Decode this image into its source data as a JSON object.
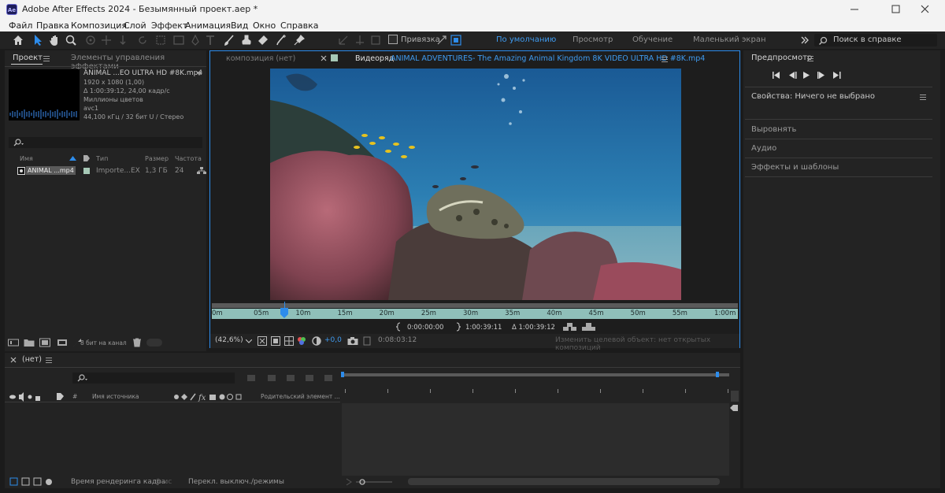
{
  "window": {
    "title": "Adobe After Effects 2024 - Безымянный проект.aep *",
    "logo": "Ae"
  },
  "menu": [
    "Файл",
    "Правка",
    "Композиция",
    "Слой",
    "Эффект",
    "Анимация",
    "Вид",
    "Окно",
    "Справка"
  ],
  "toolbar": {
    "snap_label": "Привязка",
    "workspaces": [
      "По умолчанию",
      "Просмотр",
      "Обучение",
      "Маленький экран"
    ],
    "search_placeholder": "Поиск в справке"
  },
  "project_panel": {
    "tab_project": "Проект",
    "tab_effects": "Элементы управления эффектами",
    "file_name": "ANIMAL ...EO ULTRA HD #8K.mp4",
    "info": [
      "1920 x 1080 (1,00)",
      "Δ 1:00:39:12, 24,00 кадр/с",
      "Миллионы цветов",
      "avc1",
      "44,100 кГц / 32 бит U / Стерео"
    ],
    "columns": {
      "name": "Имя",
      "type": "Тип",
      "size": "Размер",
      "rate": "Частота ..."
    },
    "rows": [
      {
        "name": "ANIMAL ...mp4",
        "type": "Importe...EX",
        "size": "1,3 ГБ",
        "rate": "24"
      }
    ],
    "bit_depth": "8 бит на канал"
  },
  "viewer": {
    "tab_comp": "композиция  (нет)",
    "tab_footage_prefix": "Видеоряд",
    "tab_footage_name": "ANIMAL ADVENTURES- The Amazing Animal Kingdom 8K VIDEO ULTRA HD #8K.mp4",
    "ruler_labels": [
      "0m",
      "05m",
      "10m",
      "15m",
      "20m",
      "25m",
      "30m",
      "35m",
      "40m",
      "45m",
      "50m",
      "55m",
      "1:00m"
    ],
    "in_point": "0:00:00:00",
    "out_point": "1:00:39:11",
    "duration": "Δ 1:00:39:12",
    "zoom": "(42,6%)",
    "exposure": "+0,0",
    "current_time": "0:08:03:12",
    "target_hint": "Изменить целевой объект: нет открытых композиций"
  },
  "right_panel": {
    "preview_title": "Предпросмотр",
    "properties": "Свойства: Ничего не выбрано",
    "items": [
      "Выровнять",
      "Аудио",
      "Эффекты и шаблоны"
    ]
  },
  "timeline": {
    "tab": "(нет)",
    "col_source": "Имя источника",
    "col_parent": "Родительский элемент ...",
    "col_hash": "#",
    "render_time_label": "Время рендеринга кадра:",
    "render_time_value": "0 мс",
    "switches": "Перекл. выключ./режимы"
  },
  "colors": {
    "accent": "#2d8ceb",
    "link_blue": "#4a90e2",
    "panel": "#232323",
    "ruler_teal": "#8fbfb9"
  }
}
